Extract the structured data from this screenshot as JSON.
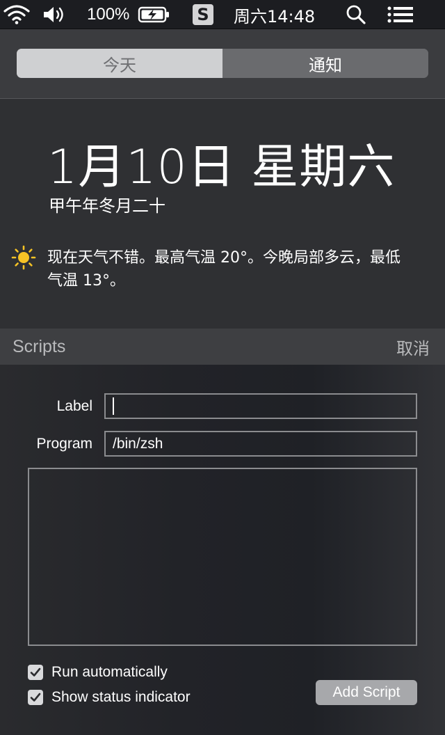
{
  "menubar": {
    "battery_percent": "100%",
    "app_badge": "S",
    "datetime": "周六14:48",
    "icons": [
      "wifi-icon",
      "volume-icon",
      "battery-charging-icon",
      "s-app-icon",
      "spotlight-search-icon",
      "notification-center-icon"
    ]
  },
  "tabs": {
    "today": "今天",
    "notifications": "通知",
    "selected": "today"
  },
  "today": {
    "date": "1月10日 星期六",
    "lunar_date": "甲午年冬月二十",
    "weather_icon": "sun-icon",
    "weather_text": "现在天气不错。最高气温 20°。今晚局部多云，最低气温 13°。"
  },
  "widget": {
    "title": "Scripts",
    "cancel_label": "取消",
    "label_field": {
      "label": "Label",
      "value": ""
    },
    "program_field": {
      "label": "Program",
      "value": "/bin/zsh"
    },
    "script_body": "",
    "options": [
      {
        "label": "Run automatically",
        "checked": true
      },
      {
        "label": "Show status indicator",
        "checked": true
      }
    ],
    "add_button_label": "Add Script"
  }
}
